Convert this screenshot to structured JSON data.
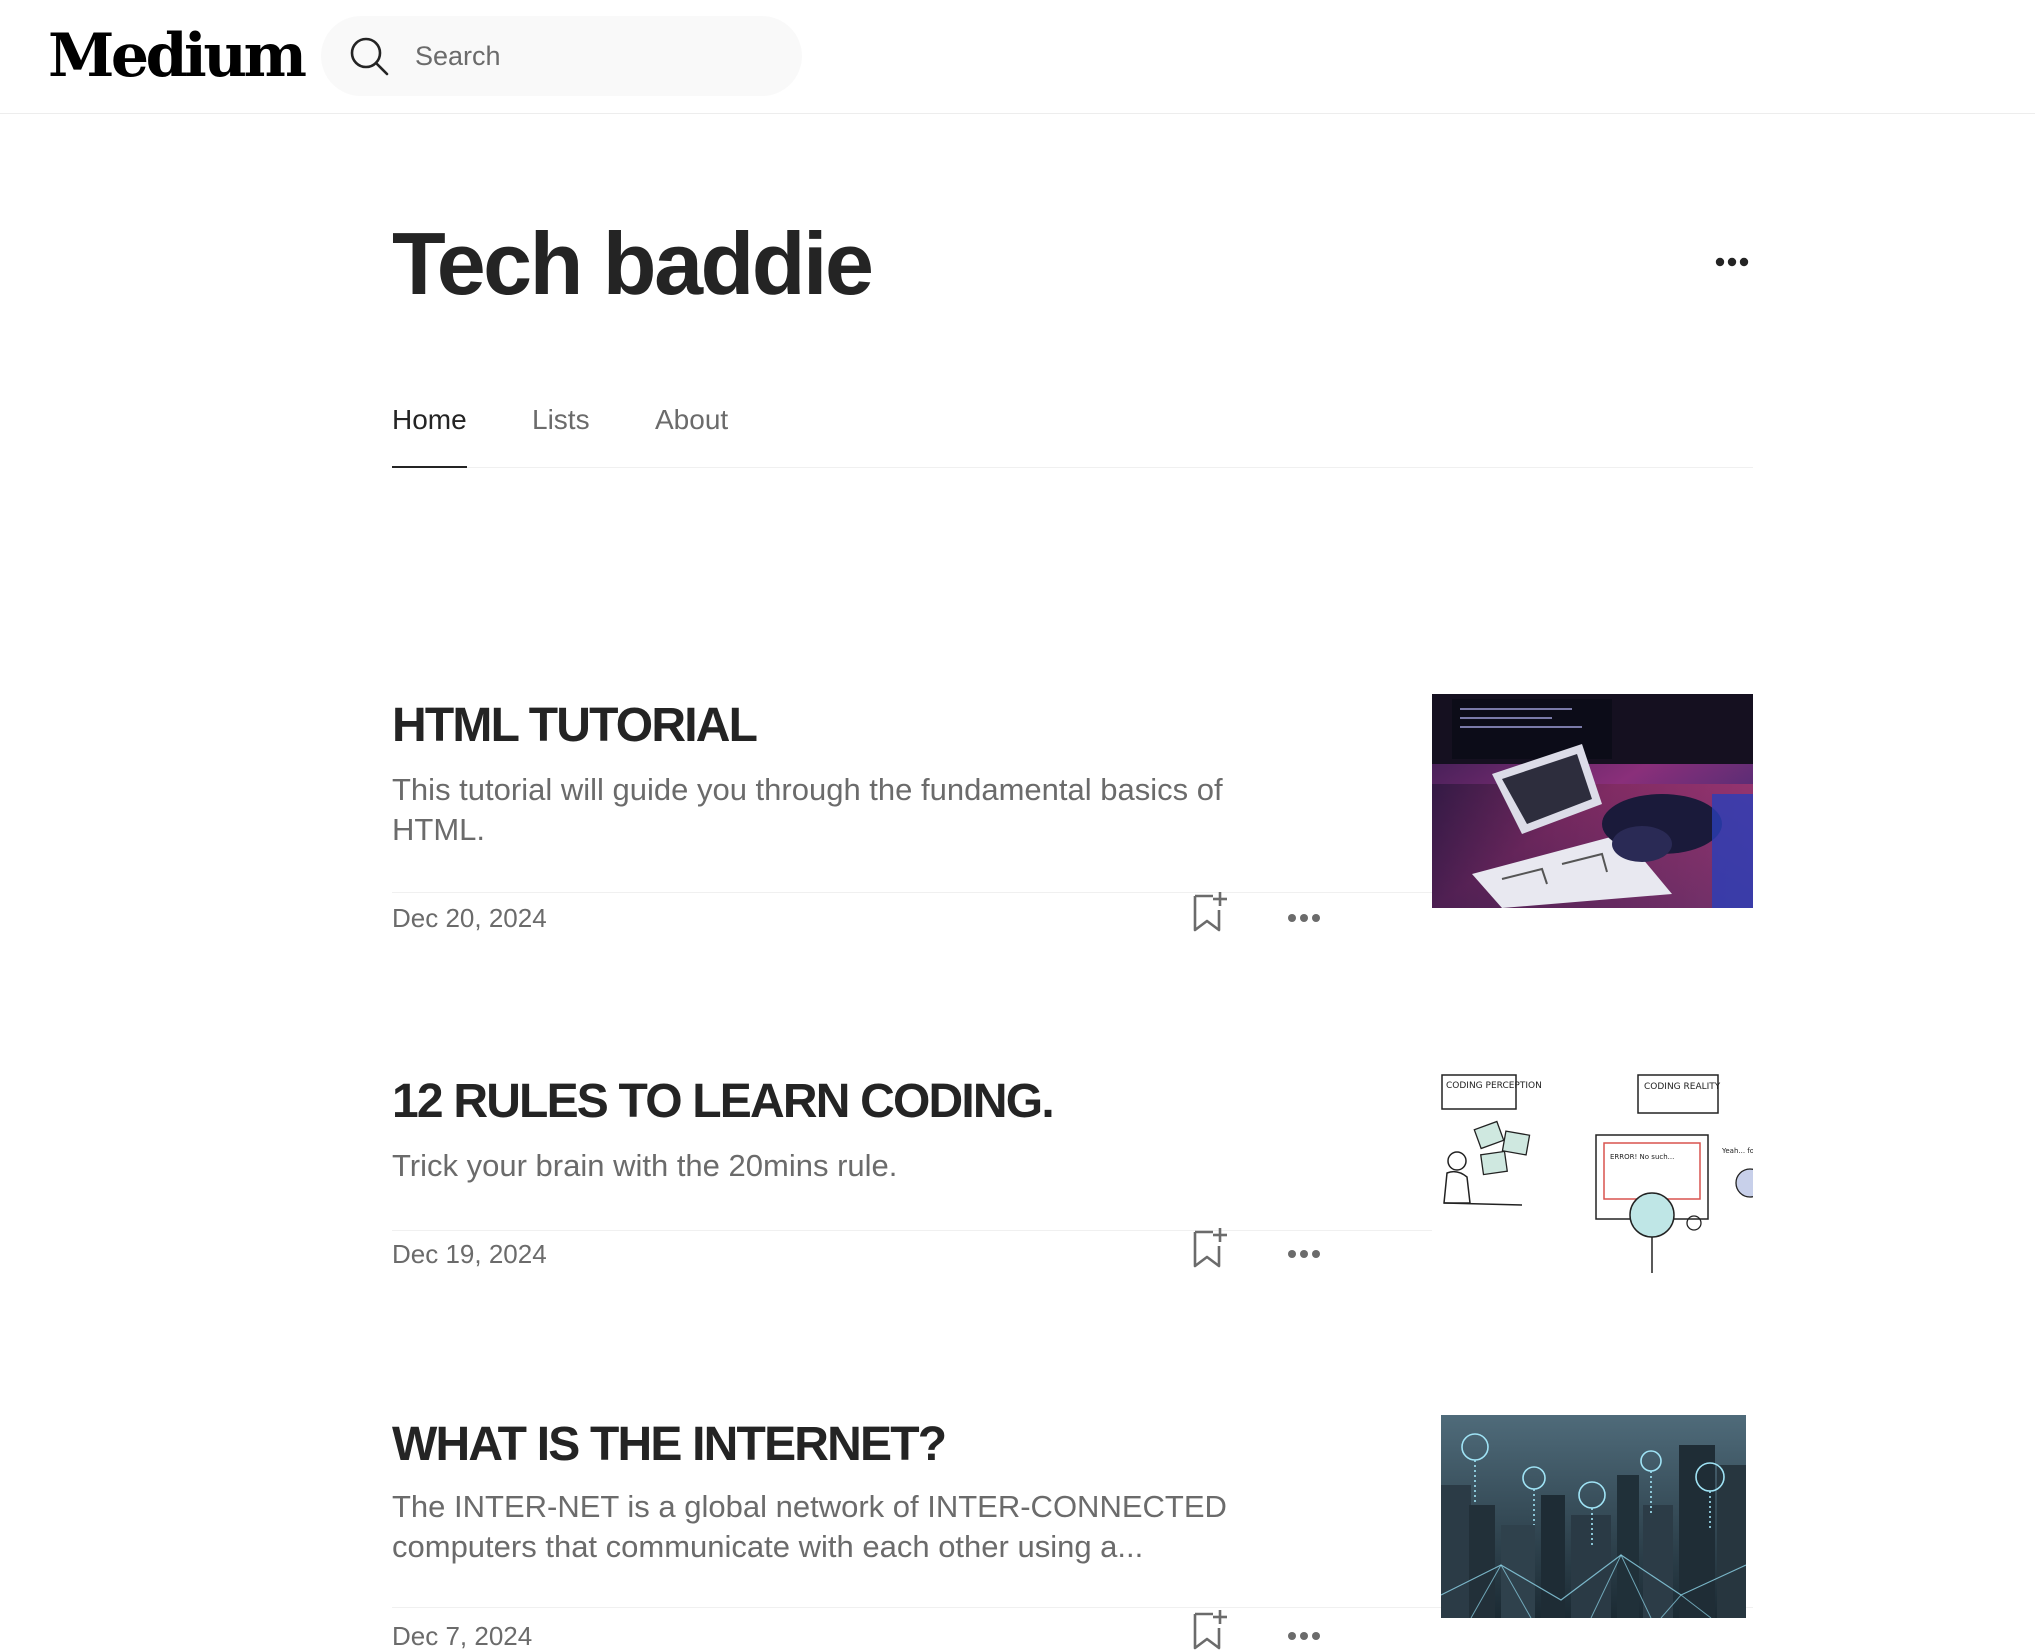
{
  "header": {
    "logo": "Medium",
    "search_placeholder": "Search"
  },
  "publication": {
    "title": "Tech baddie"
  },
  "tabs": [
    {
      "label": "Home",
      "active": true
    },
    {
      "label": "Lists",
      "active": false
    },
    {
      "label": "About",
      "active": false
    }
  ],
  "articles": [
    {
      "title": "HTML TUTORIAL",
      "subtitle": "This tutorial will guide you through the fundamental basics of HTML.",
      "date": "Dec 20, 2024",
      "thumbnail": "laptop-coding-neon-icon"
    },
    {
      "title": "12 RULES TO LEARN CODING.",
      "subtitle": "Trick your brain with the 20mins rule.",
      "date": "Dec 19, 2024",
      "thumbnail": "coding-perception-reality-sketch-icon",
      "thumb_text": {
        "left_sign": "CODING PERCEPTION",
        "right_sign": "CODING REALITY",
        "screen": "ERROR! No such...",
        "side_note": "Yeah... forgot"
      }
    },
    {
      "title": "WHAT IS THE INTERNET?",
      "subtitle": "The INTER-NET is a global network of INTER-CONNECTED computers that communicate with each other using a...",
      "date": "Dec 7, 2024",
      "thumbnail": "network-city-skyline-icon"
    }
  ],
  "colors": {
    "text_primary": "#242424",
    "text_secondary": "#6b6b6b",
    "divider": "#f0f0f0",
    "search_bg": "#f9f9f9"
  }
}
